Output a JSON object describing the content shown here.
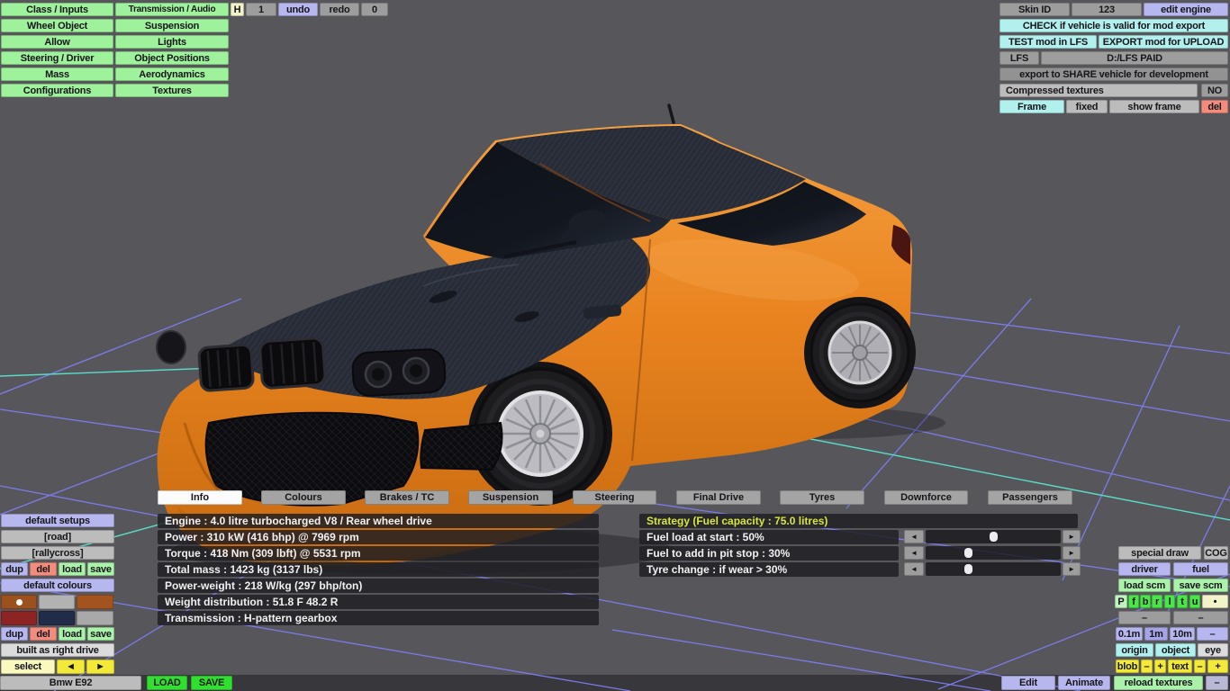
{
  "colors": {
    "background": "#57575b",
    "bottom_strip": "#38383c",
    "grid_line": "#7d7df2",
    "grid_highlight": "#58dcc8",
    "car_body": "#e8831f",
    "car_body_light": "#f5a040",
    "carbon": "#272c37",
    "glass": "#12161e",
    "rim_silver": "#bcbcc2"
  },
  "menu": {
    "col1": [
      "Class / Inputs",
      "Wheel Object",
      "Allow",
      "Steering / Driver",
      "Mass",
      "Configurations"
    ],
    "col2": [
      "Transmission / Audio",
      "Suspension",
      "Lights",
      "Object Positions",
      "Aerodynamics",
      "Textures"
    ]
  },
  "topbar": {
    "h": "H",
    "one": "1",
    "undo": "undo",
    "redo": "redo",
    "zero": "0"
  },
  "topright": {
    "skin_id": "Skin ID",
    "skin_id_value": "123",
    "edit_engine": "edit engine",
    "check": "CHECK if vehicle is valid for mod export",
    "test": "TEST mod in LFS",
    "export_upload": "EXPORT mod for UPLOAD",
    "lfs": "LFS",
    "lfs_path": "D:/LFS PAID",
    "share": "export to SHARE vehicle for development",
    "compressed": "Compressed textures",
    "compressed_value": "NO",
    "frame": "Frame",
    "fixed": "fixed",
    "show_frame": "show frame",
    "del": "del"
  },
  "setups": {
    "default_setups": "default setups",
    "items": [
      "[road]",
      "[rallycross]"
    ],
    "dup": "dup",
    "del": "del",
    "load": "load",
    "save": "save",
    "default_colours": "default colours",
    "built_as": "built as right drive",
    "select": "select",
    "prev": "◄",
    "next": "►"
  },
  "swatches": {
    "colors": [
      "#9c501e",
      "#b2b2b2",
      "#a3541e",
      "#8c2424",
      "#202c48",
      "#a9a9a9"
    ],
    "selected_index": 0
  },
  "tabs": {
    "items": [
      "Info",
      "Colours",
      "Brakes / TC",
      "Suspension",
      "Steering",
      "Final Drive",
      "Tyres",
      "Downforce",
      "Passengers"
    ],
    "selected": "Info"
  },
  "info": {
    "rows": [
      "Engine : 4.0 litre turbocharged V8 / Rear wheel drive",
      "Power : 310 kW (416 bhp) @ 7969 rpm",
      "Torque : 418 Nm (309 lbft) @ 5531 rpm",
      "Total mass : 1423 kg (3137 lbs)",
      "Power-weight : 218 W/kg (297 bhp/ton)",
      "Weight distribution : 51.8 F  48.2 R",
      "Transmission : H-pattern gearbox"
    ]
  },
  "strategy": {
    "header": "Strategy (Fuel capacity : 75.0 litres)",
    "header_color": "#d9e63c",
    "arrow_left": "◄",
    "arrow_right": "►",
    "rows": [
      {
        "label": "Fuel load at start : 50%",
        "value": 50
      },
      {
        "label": "Fuel to add in pit stop : 30%",
        "value": 30
      },
      {
        "label": "Tyre change : if wear > 30%",
        "value": 30
      }
    ]
  },
  "rightpanel": {
    "special_draw": "special draw",
    "cog": "COG",
    "driver": "driver",
    "fuel": "fuel",
    "load_scm": "load scm",
    "save_scm": "save scm",
    "letters": [
      "P",
      "f",
      "b",
      "r",
      "l",
      "t",
      "u",
      "•"
    ],
    "dash": "–",
    "scale": [
      "0.1m",
      "1m",
      "10m",
      "–"
    ],
    "origin": "origin",
    "object": "object",
    "eye": "eye",
    "blob": "blob",
    "minus": "–",
    "plus": "+",
    "text": "text",
    "reload_textures": "reload textures"
  },
  "bottombar": {
    "vehicle": "Bmw E92",
    "load": "LOAD",
    "save": "SAVE",
    "edit": "Edit",
    "animate": "Animate",
    "reload_textures": "reload textures",
    "dash": "–"
  }
}
